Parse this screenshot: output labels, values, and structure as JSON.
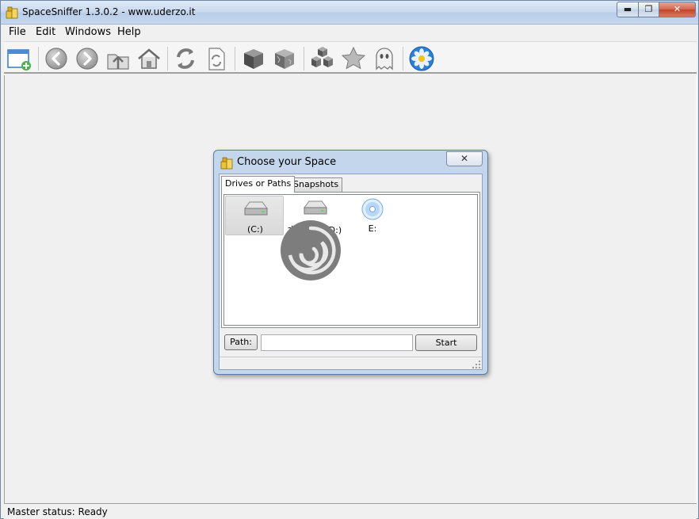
{
  "window": {
    "title": "SpaceSniffer 1.3.0.2 - www.uderzo.it",
    "caption_buttons": {
      "minimize": "▬",
      "maximize": "❐",
      "close": "✕"
    }
  },
  "menu": {
    "items": [
      {
        "label": "File"
      },
      {
        "label": "Edit"
      },
      {
        "label": "Windows"
      },
      {
        "label": "Help"
      }
    ]
  },
  "toolbar": {
    "buttons": [
      {
        "icon": "new-window-icon"
      },
      {
        "icon": "back-icon"
      },
      {
        "icon": "forward-icon"
      },
      {
        "icon": "up-folder-icon"
      },
      {
        "icon": "home-icon"
      },
      {
        "icon": "refresh-icon"
      },
      {
        "icon": "refresh-document-icon"
      },
      {
        "icon": "cube-dark-icon"
      },
      {
        "icon": "cube-rough-icon"
      },
      {
        "icon": "cubes-icon"
      },
      {
        "icon": "star-icon"
      },
      {
        "icon": "ghost-icon"
      },
      {
        "icon": "flower-icon"
      }
    ]
  },
  "dialog": {
    "title": "Choose your Space",
    "close_label": "✕",
    "tabs": [
      {
        "label": "Drives or Paths",
        "active": true
      },
      {
        "label": "Snapshots",
        "active": false
      }
    ],
    "drives": [
      {
        "label": "(C:)",
        "icon": "hard-drive-icon",
        "selected": true
      },
      {
        "label": "本地磁盘 (D:)",
        "icon": "hard-drive-icon",
        "selected": false
      },
      {
        "label": "E:",
        "icon": "cd-drive-icon",
        "selected": false
      }
    ],
    "path_button": "Path:",
    "path_value": "",
    "start_button": "Start"
  },
  "status": {
    "text": "Master status: Ready"
  }
}
